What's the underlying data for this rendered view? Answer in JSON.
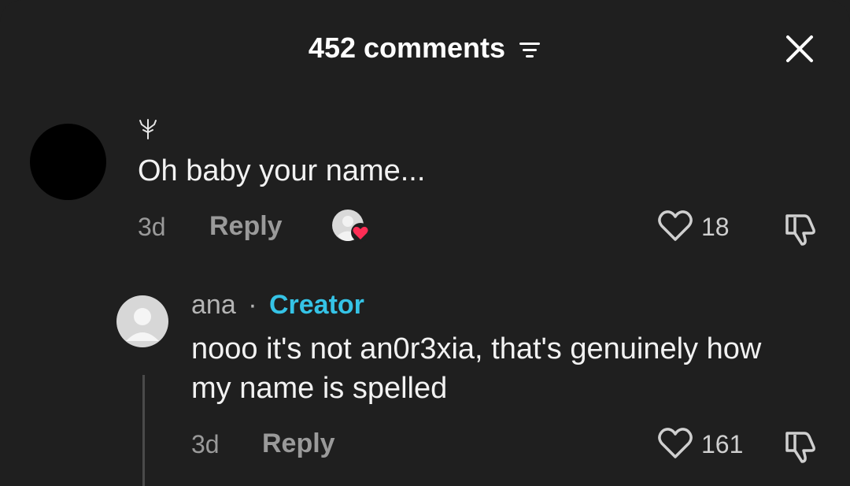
{
  "header": {
    "title": "452 comments"
  },
  "comments": [
    {
      "text": "Oh baby your name...",
      "time": "3d",
      "reply_label": "Reply",
      "likes": "18"
    }
  ],
  "replies": [
    {
      "author": "ana",
      "separator": "·",
      "badge": "Creator",
      "text": "nooo it's not an0r3xia, that's genuinely how my name is spelled",
      "time": "3d",
      "reply_label": "Reply",
      "likes": "161"
    }
  ],
  "colors": {
    "background": "#1f1f1f",
    "creator_badge": "#35c3e6",
    "heart_badge": "#ff2d55"
  },
  "icons": [
    "filter-icon",
    "close-icon",
    "tree-icon",
    "heart-icon",
    "dislike-icon",
    "creator-liked-icon",
    "default-avatar-icon"
  ]
}
